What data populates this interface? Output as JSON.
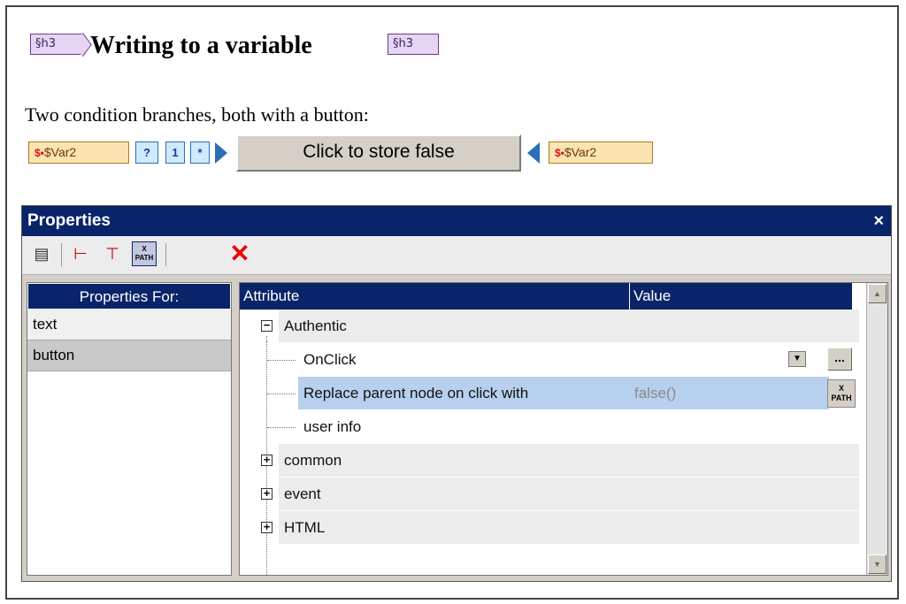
{
  "document": {
    "h3_tag_start": "§h3",
    "h3_tag_end": "§h3",
    "heading": "Writing to a variable",
    "paragraph": "Two condition branches, both with a button:",
    "var_tag_start": "$Var2",
    "var_tag_end": "$Var2",
    "condition_labels": [
      "?",
      "1",
      "*"
    ],
    "button_label": "Click to store false"
  },
  "properties": {
    "title": "Properties",
    "close_glyph": "×",
    "toolbar": {
      "delete_glyph": "✕",
      "xpath_label_top": "X",
      "xpath_label_bottom": "PATH"
    },
    "properties_for_header": "Properties For:",
    "properties_for_items": [
      "text",
      "button"
    ],
    "columns": {
      "attribute": "Attribute",
      "value": "Value"
    },
    "groups": {
      "authentic": "Authentic",
      "common": "common",
      "event": "event",
      "html": "HTML"
    },
    "attributes": {
      "onclick": "OnClick",
      "replace": "Replace parent node on click with",
      "replace_value": "false()",
      "user_info": "user info"
    },
    "expand_glyph": "+",
    "collapse_glyph": "−",
    "ellipsis": "...",
    "colors": {
      "title_bar": "#0a246a",
      "selection": "#b7d0ee"
    }
  }
}
